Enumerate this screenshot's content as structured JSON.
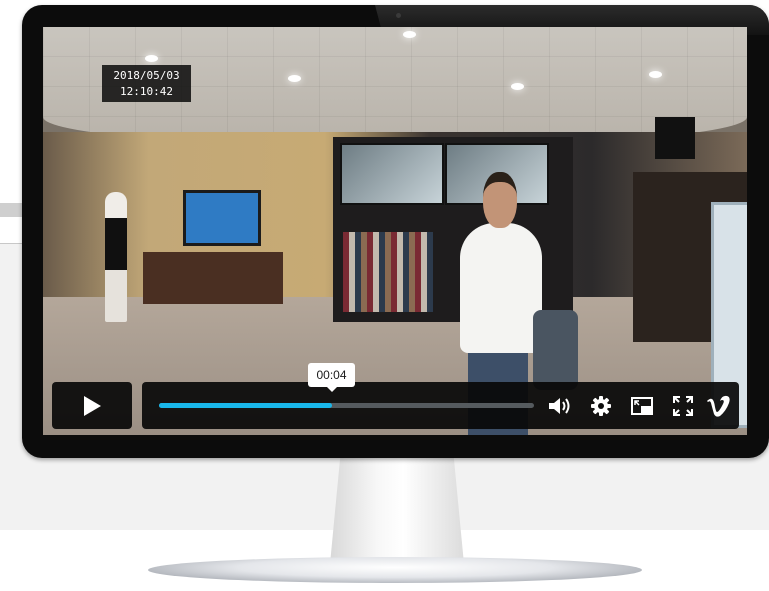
{
  "overlay": {
    "date": "2018/05/03",
    "time": "12:10:42"
  },
  "player": {
    "current_time": "00:04",
    "progress": 0.46,
    "accent_color": "#19b7ea",
    "controls": {
      "play": "play-icon",
      "volume": "volume-icon",
      "settings": "gear-icon",
      "pip": "picture-in-picture-icon",
      "fullscreen": "fullscreen-icon",
      "brand": "vimeo-logo-icon"
    }
  }
}
